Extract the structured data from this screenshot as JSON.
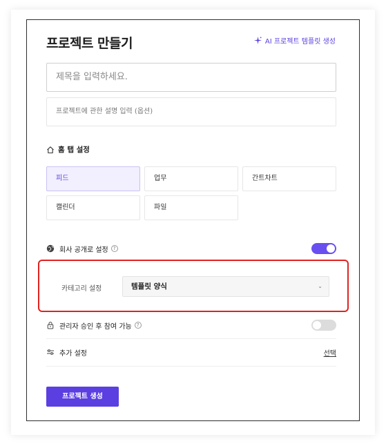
{
  "modal": {
    "title": "프로젝트 만들기",
    "ai_template_link": "AI 프로젝트 템플릿 생성"
  },
  "form": {
    "title_placeholder": "제목을 입력하세요.",
    "description_placeholder": "프로젝트에 관한 설명 입력 (옵션)"
  },
  "home_tab": {
    "label": "홈 탭 설정",
    "options": [
      "피드",
      "업무",
      "간트차트",
      "캘린더",
      "파일"
    ],
    "selected": "피드"
  },
  "company_public": {
    "label": "회사 공개로 설정",
    "help": "?",
    "enabled": true
  },
  "category": {
    "label": "카테고리 설정",
    "selected_value": "템플릿 양식",
    "chevron": "⌄"
  },
  "admin_approval": {
    "label": "관리자 승인 후 참여 가능",
    "help": "?",
    "enabled": false
  },
  "extra_settings": {
    "label": "추가 설정",
    "action": "선택"
  },
  "footer": {
    "create_button": "프로젝트 생성"
  },
  "colors": {
    "accent": "#5b3fe0",
    "highlight_border": "#e0211f",
    "toggle_off": "#dcdcdc"
  }
}
